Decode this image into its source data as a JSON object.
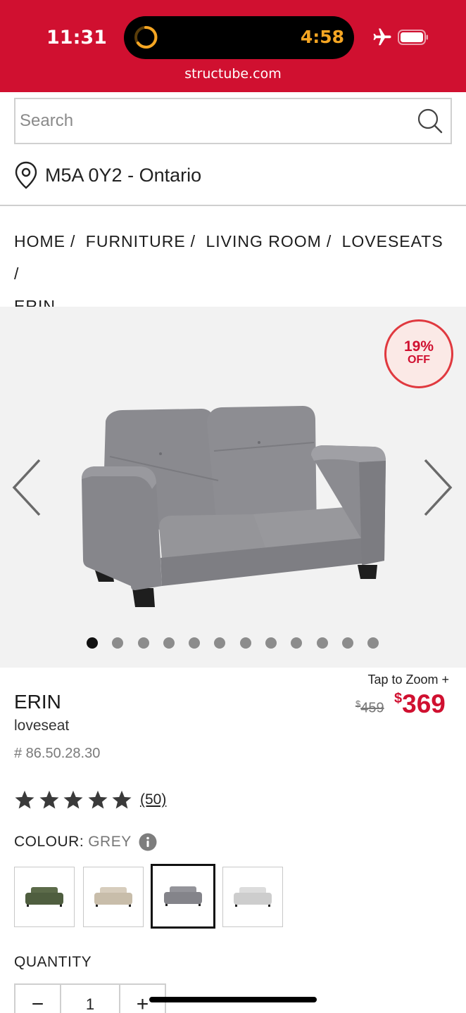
{
  "status_bar": {
    "time": "11:31",
    "timer": "4:58",
    "url": "structube.com"
  },
  "search": {
    "placeholder": "Search",
    "value": ""
  },
  "location": {
    "text": "M5A 0Y2 - Ontario"
  },
  "breadcrumb": [
    "HOME",
    "FURNITURE",
    "LIVING ROOM",
    "LOVESEATS",
    "ERIN"
  ],
  "gallery": {
    "badge_pct": "19%",
    "badge_off": "OFF",
    "image_count": 12,
    "active_index": 0
  },
  "product": {
    "title": "ERIN",
    "subtitle": "loveseat",
    "sku": "# 86.50.28.30",
    "zoom_label": "Tap to Zoom +",
    "old_price": "459",
    "new_price": "369",
    "currency": "$",
    "rating": 5,
    "review_count": "(50)"
  },
  "colour": {
    "label": "COLOUR:",
    "value": "GREY",
    "swatches": [
      {
        "name": "green",
        "color": "#5c6b4a"
      },
      {
        "name": "beige",
        "color": "#cfc4b3"
      },
      {
        "name": "grey",
        "color": "#8e8e94",
        "selected": true
      },
      {
        "name": "light-grey",
        "color": "#d6d6d6"
      }
    ]
  },
  "quantity": {
    "label": "QUANTITY",
    "value": "1",
    "minus": "−",
    "plus": "+"
  }
}
